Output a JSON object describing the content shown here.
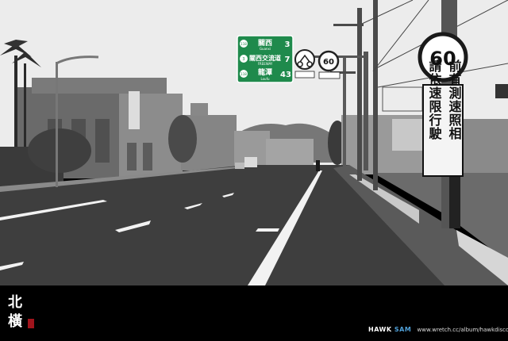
{
  "photo": {
    "sign_green": {
      "row1": {
        "route": "118",
        "name": "關西",
        "roman": "Guanxi",
        "km": "3"
      },
      "row2": {
        "route": "3",
        "name": "關西交流道",
        "roman": "FREEWAY",
        "km": "7"
      },
      "row3": {
        "route": "118",
        "name": "龍潭",
        "roman": "Loufu",
        "km": "43"
      }
    },
    "speed_sign_small": "60",
    "speed_sign_big": "60",
    "warning_sign": {
      "col_right": "前有測速照相",
      "col_left": "請依速限行駛"
    },
    "colors": {
      "sky": "#ececec",
      "road": "#3e3e3e",
      "sign_green": "#1f8a4c"
    }
  },
  "caption": {
    "title_char_1": "北",
    "title_char_2": "橫",
    "brand_part_1": "HAWK",
    "brand_part_2": "SAM",
    "credit_url": "www.wretch.cc/album/hawkdiscover"
  }
}
